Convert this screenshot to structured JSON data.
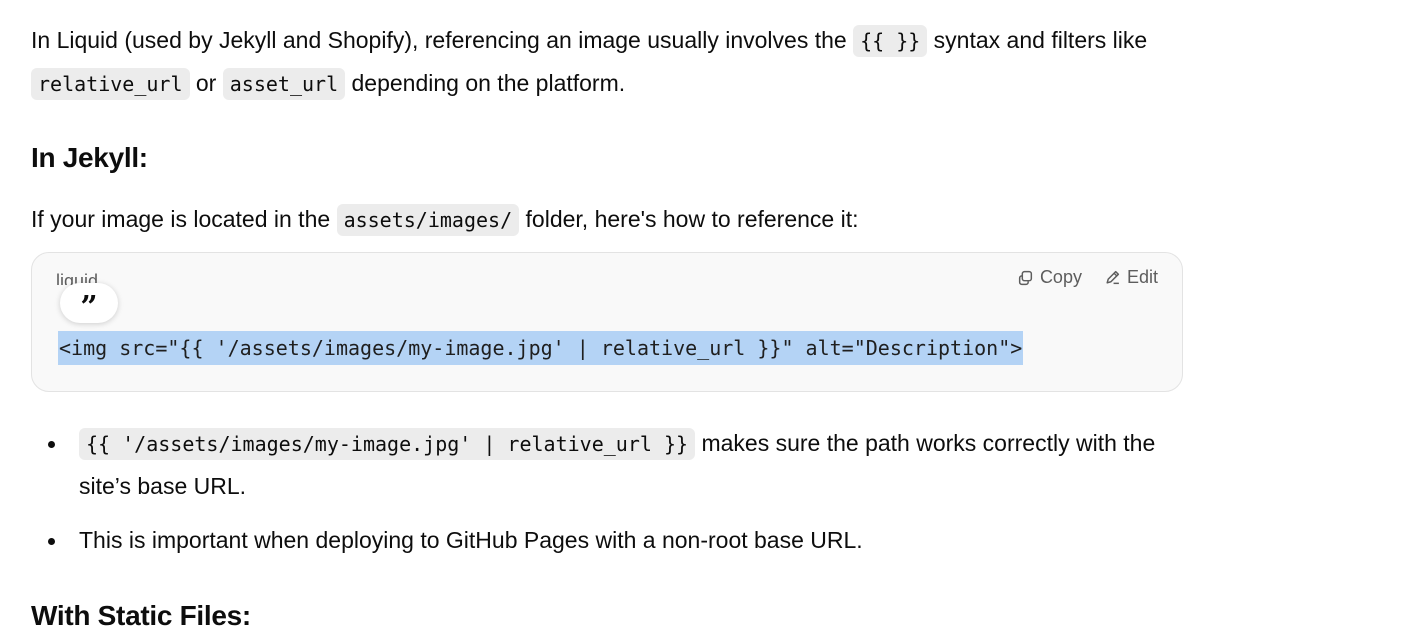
{
  "intro": {
    "text1": "In Liquid (used by Jekyll and Shopify), referencing an image usually involves the ",
    "code1": "{{ }}",
    "text2": " syntax and filters like ",
    "code2": "relative_url",
    "text3": " or ",
    "code3": "asset_url",
    "text4": " depending on the platform."
  },
  "jekyll": {
    "heading": "In Jekyll:",
    "text1": "If your image is located in the ",
    "code1": "assets/images/",
    "text2": " folder, here's how to reference it:"
  },
  "codeblock": {
    "language": "liquid",
    "copy_label": "Copy",
    "edit_label": "Edit",
    "quote_glyph": "”",
    "code": "<img src=\"{{ '/assets/images/my-image.jpg' | relative_url }}\" alt=\"Description\">"
  },
  "bullets": [
    {
      "code": "{{ '/assets/images/my-image.jpg' | relative_url }}",
      "text": " makes sure the path works correctly with the site’s base URL."
    },
    {
      "text": "This is important when deploying to GitHub Pages with a non-root base URL."
    }
  ],
  "static": {
    "heading": "With Static Files:"
  }
}
